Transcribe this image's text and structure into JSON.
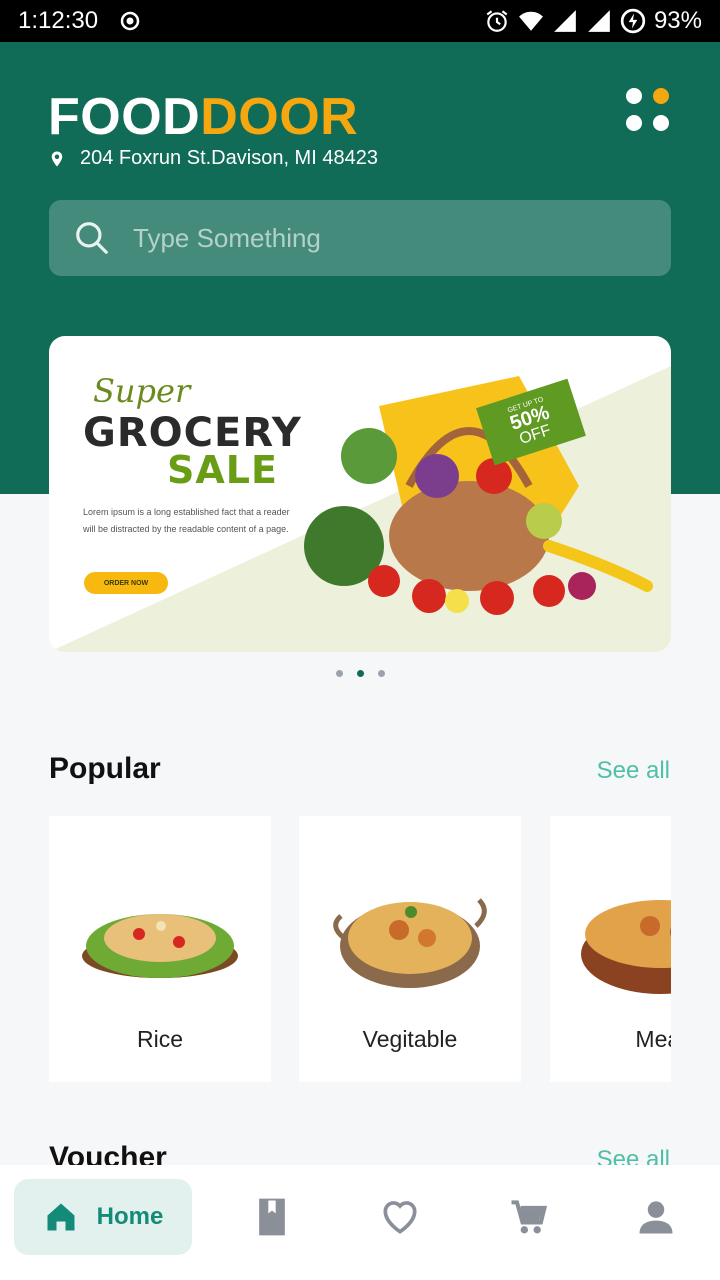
{
  "status_bar": {
    "time": "1:12:30",
    "battery": "93%"
  },
  "header": {
    "brand_part1": "FOOD",
    "brand_part2": "DOOR",
    "address": "204 Foxrun St.Davison, MI 48423"
  },
  "search": {
    "placeholder": "Type Something"
  },
  "banner": {
    "super": "Super",
    "grocery": "GROCERY",
    "sale": "SALE",
    "description": "Lorem ipsum is a long established fact that a reader will be distracted by the readable content of a page.",
    "cta": "ORDER NOW",
    "offer_top": "GET UP TO",
    "offer_value": "50%",
    "offer_word": "OFF",
    "pager_count": 3,
    "pager_active_index": 1
  },
  "popular": {
    "title": "Popular",
    "see_all": "See all",
    "items": [
      {
        "label": "Rice"
      },
      {
        "label": "Vegitable"
      },
      {
        "label": "Meat"
      }
    ]
  },
  "voucher": {
    "title": "Voucher",
    "see_all": "See all"
  },
  "bottom_nav": {
    "home_label": "Home",
    "items": [
      "home-icon",
      "book-icon",
      "heart-icon",
      "cart-icon",
      "person-icon"
    ]
  },
  "colors": {
    "brand_green": "#106b57",
    "brand_orange": "#f5a70f",
    "accent_teal": "#4fbfa8"
  }
}
